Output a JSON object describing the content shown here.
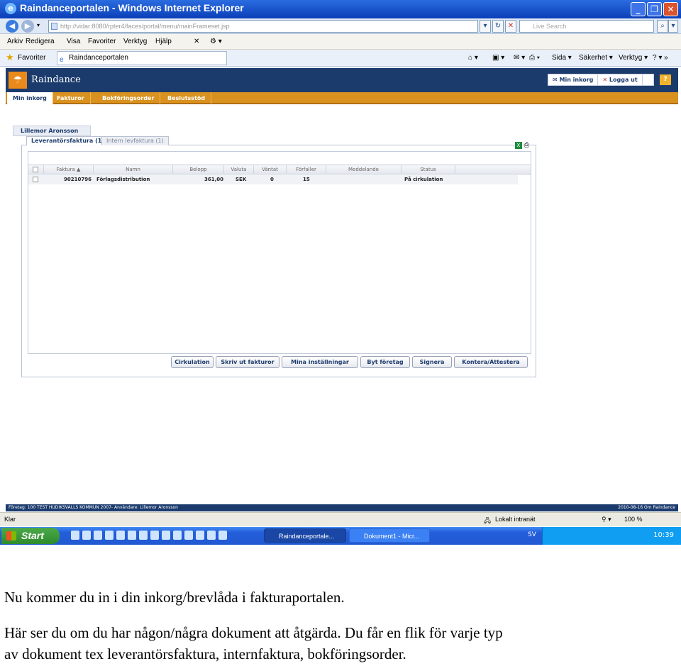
{
  "window": {
    "title": "Raindanceportalen - Windows Internet Explorer",
    "buttons": [
      "_",
      "❐",
      "✕"
    ]
  },
  "addressbar": {
    "url": "http://vidar:8080/rpter4/faces/portal/menu/mainFrameset.jsp",
    "search_placeholder": "Live Search"
  },
  "menubar": [
    "Arkiv",
    "Redigera",
    "Visa",
    "Favoriter",
    "Verktyg",
    "Hjälp"
  ],
  "favbar": {
    "favorites_label": "Favoriter",
    "tab_label": "Raindanceportalen",
    "tools": [
      "Sida ▾",
      "Säkerhet ▾",
      "Verktyg ▾"
    ]
  },
  "app": {
    "name": "Raindance",
    "header_buttons": [
      "Min inkorg",
      "Logga ut"
    ],
    "help": "?",
    "tabs": [
      "Min inkorg",
      "Fakturor",
      "Bokföringsorder",
      "Beslutsstöd"
    ],
    "user": "Lillemor Aronsson",
    "doc_tabs": [
      "Leverantörsfaktura (1)",
      "Intern levfaktura (1)"
    ],
    "columns": [
      "Faktura ▲",
      "Namn",
      "Belopp",
      "Valuta",
      "Väntat",
      "Förfaller",
      "Meddelande",
      "Status"
    ],
    "rows": [
      {
        "faktura": "90210796",
        "namn": "Förlagsdistribution",
        "belopp": "361,00",
        "valuta": "SEK",
        "vantat": "0",
        "forfaller": "15",
        "meddelande": "",
        "status": "På cirkulation"
      }
    ],
    "buttons": [
      "Cirkulation",
      "Skriv ut fakturor",
      "Mina inställningar",
      "Byt företag",
      "Signera",
      "Kontera/Attestera"
    ],
    "status_left": "Företag: 100 TEST HUDIKSVALLS KOMMUN 2007-  Användare: Lillemor Aronsson",
    "status_right": "2010-08-16  Om Raindance"
  },
  "iestatus": {
    "left": "Klar",
    "zone": "Lokalt intranät",
    "zoom": "100 %"
  },
  "taskbar": {
    "start": "Start",
    "tasks": [
      "Raindanceportale...",
      "Dokument1 - Micr..."
    ],
    "lang": "SV",
    "clock": "10:39"
  },
  "caption": {
    "line1": "Nu kommer du in i din inkorg/brevlåda i fakturaportalen.",
    "line2": "Här ser du om du har någon/några dokument att åtgärda. Du får en flik för varje typ",
    "line3": "av dokument tex leverantörsfaktura, internfaktura, bokföringsorder."
  }
}
